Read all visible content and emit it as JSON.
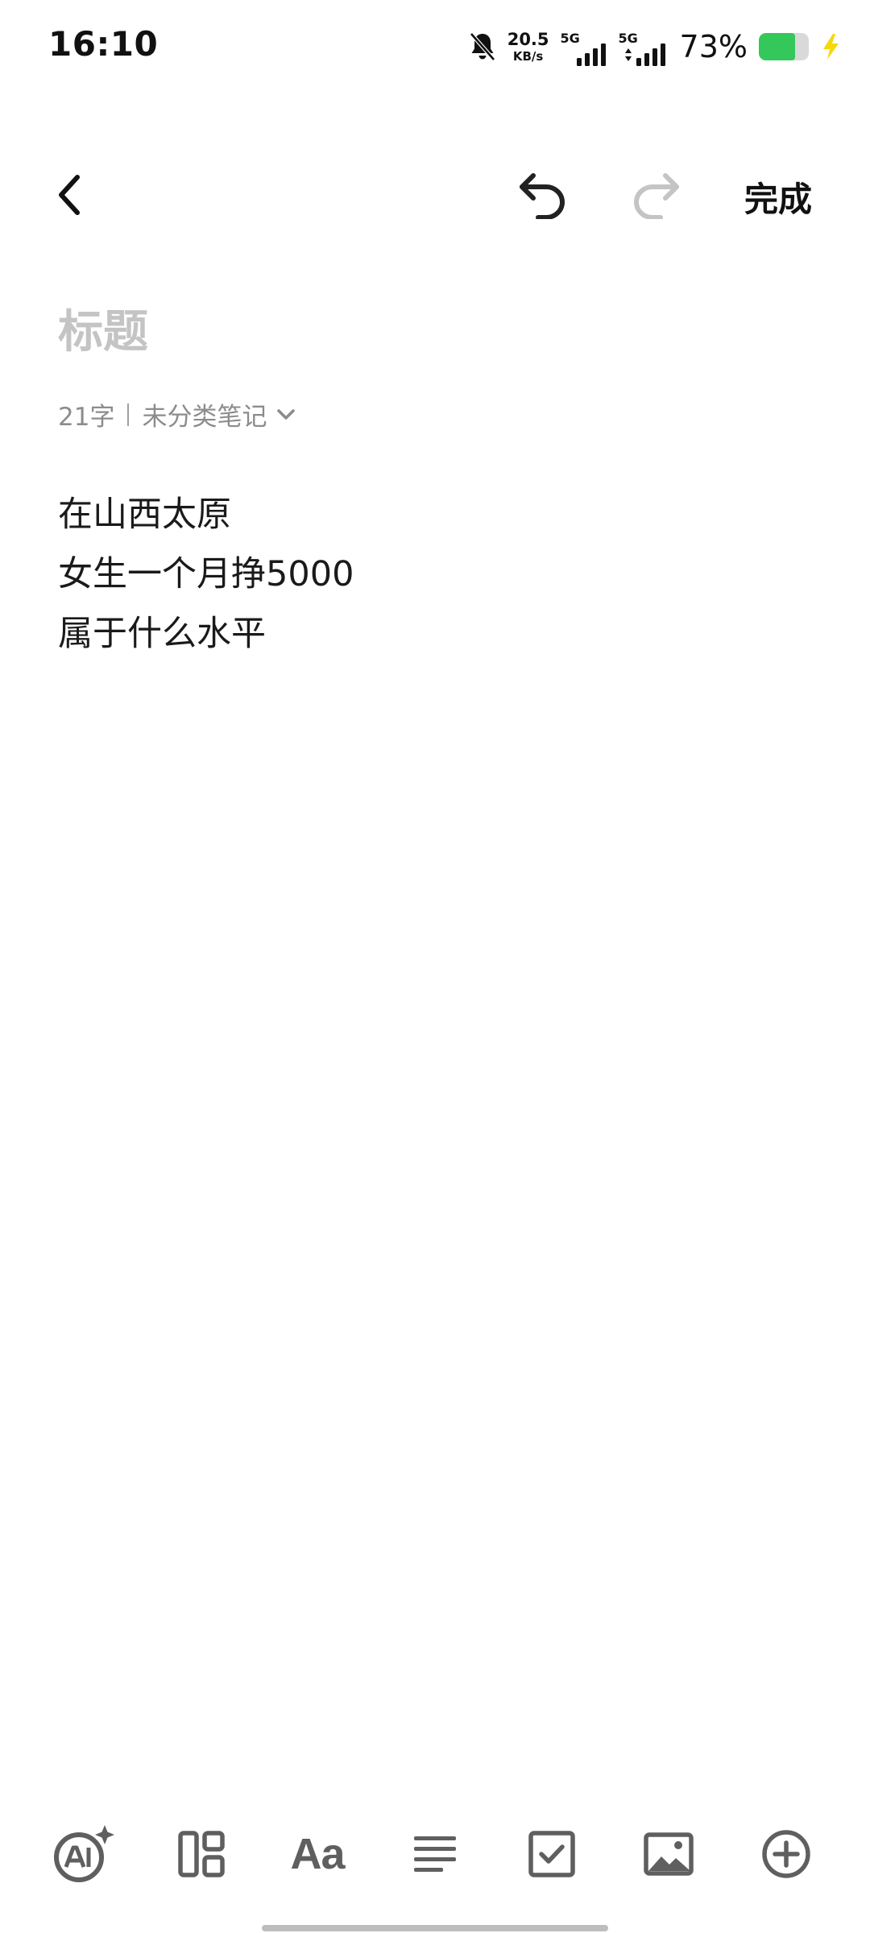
{
  "status_bar": {
    "time": "16:10",
    "net_speed_value": "20.5",
    "net_speed_unit": "KB/s",
    "sim1_type": "5G",
    "sim2_type": "5G",
    "battery_percent": "73%",
    "battery_level": 0.73,
    "icons": [
      "bell-muted-icon",
      "signal-icon",
      "battery-icon",
      "charging-bolt-icon"
    ],
    "battery_color": "#34c759",
    "bolt_color": "#f5d90a"
  },
  "toolbar": {
    "back_icon": "chevron-left-icon",
    "undo_icon": "undo-icon",
    "redo_icon": "redo-icon",
    "done_label": "完成"
  },
  "note": {
    "title_value": "",
    "title_placeholder": "标题",
    "char_count": "21字",
    "category": "未分类笔记",
    "body_lines": [
      "在山西太原",
      "女生一个月挣5000",
      "属于什么水平"
    ]
  },
  "bottom_toolbar": {
    "tools": [
      "ai-sparkle-icon",
      "layout-icon",
      "text-format-icon",
      "align-left-icon",
      "checkbox-icon",
      "image-icon",
      "add-circle-icon"
    ],
    "text_format_glyph": "Aa"
  }
}
